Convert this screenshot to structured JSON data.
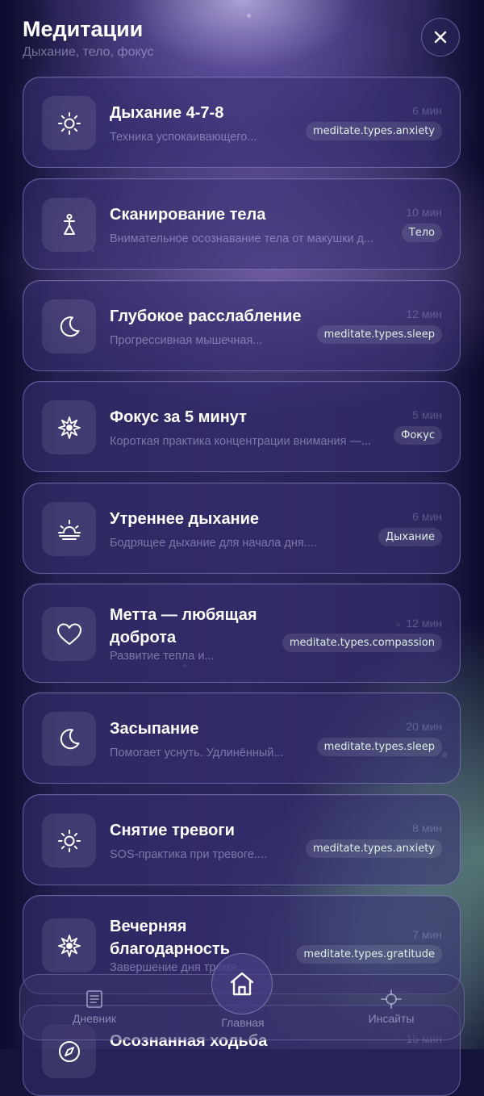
{
  "header": {
    "title": "Медитации",
    "subtitle": "Дыхание, тело, фокус"
  },
  "close_icon": "close-icon",
  "meditations": [
    {
      "title": "Дыхание 4-7-8",
      "description": "Техника успокаивающего...",
      "duration": "6 мин",
      "tag": "meditate.types.anxiety",
      "icon": "sun-icon"
    },
    {
      "title": "Сканирование тела",
      "description": "Внимательное осознавание тела от макушки д...",
      "duration": "10 мин",
      "tag": "Тело",
      "icon": "body-figure-icon"
    },
    {
      "title": "Глубокое расслабление",
      "description": "Прогрессивная мышечная...",
      "duration": "12 мин",
      "tag": "meditate.types.sleep",
      "icon": "moon-icon"
    },
    {
      "title": "Фокус за 5 минут",
      "description": "Короткая практика концентрации внимания —...",
      "duration": "5 мин",
      "tag": "Фокус",
      "icon": "star-burst-icon"
    },
    {
      "title": "Утреннее дыхание",
      "description": "Бодрящее дыхание для начала дня....",
      "duration": "6 мин",
      "tag": "Дыхание",
      "icon": "sunrise-icon"
    },
    {
      "title": "Метта — любящая доброта",
      "description": "Развитие тепла и...",
      "duration": "12 мин",
      "tag": "meditate.types.compassion",
      "icon": "heart-icon"
    },
    {
      "title": "Засыпание",
      "description": "Помогает уснуть. Удлинённый...",
      "duration": "20 мин",
      "tag": "meditate.types.sleep",
      "icon": "moon-icon"
    },
    {
      "title": "Снятие тревоги",
      "description": "SOS-практика при тревоге....",
      "duration": "8 мин",
      "tag": "meditate.types.anxiety",
      "icon": "sun-icon"
    },
    {
      "title": "Вечерняя благодарность",
      "description": "Завершение дня тремя...",
      "duration": "7 мин",
      "tag": "meditate.types.gratitude",
      "icon": "star-burst-icon"
    },
    {
      "title": "Осознанная ходьба",
      "description": "",
      "duration": "15 мин",
      "tag": "",
      "icon": "compass-icon"
    }
  ],
  "tabbar": {
    "items": [
      {
        "label": "Дневник",
        "icon": "journal-icon"
      },
      {
        "label": "Главная",
        "icon": "home-icon",
        "active": true
      },
      {
        "label": "Инсайты",
        "icon": "crosshair-icon"
      }
    ]
  },
  "colors": {
    "tag_text": "#dcefe5",
    "card_border": "#aaa5eb",
    "title": "#ffffff"
  }
}
